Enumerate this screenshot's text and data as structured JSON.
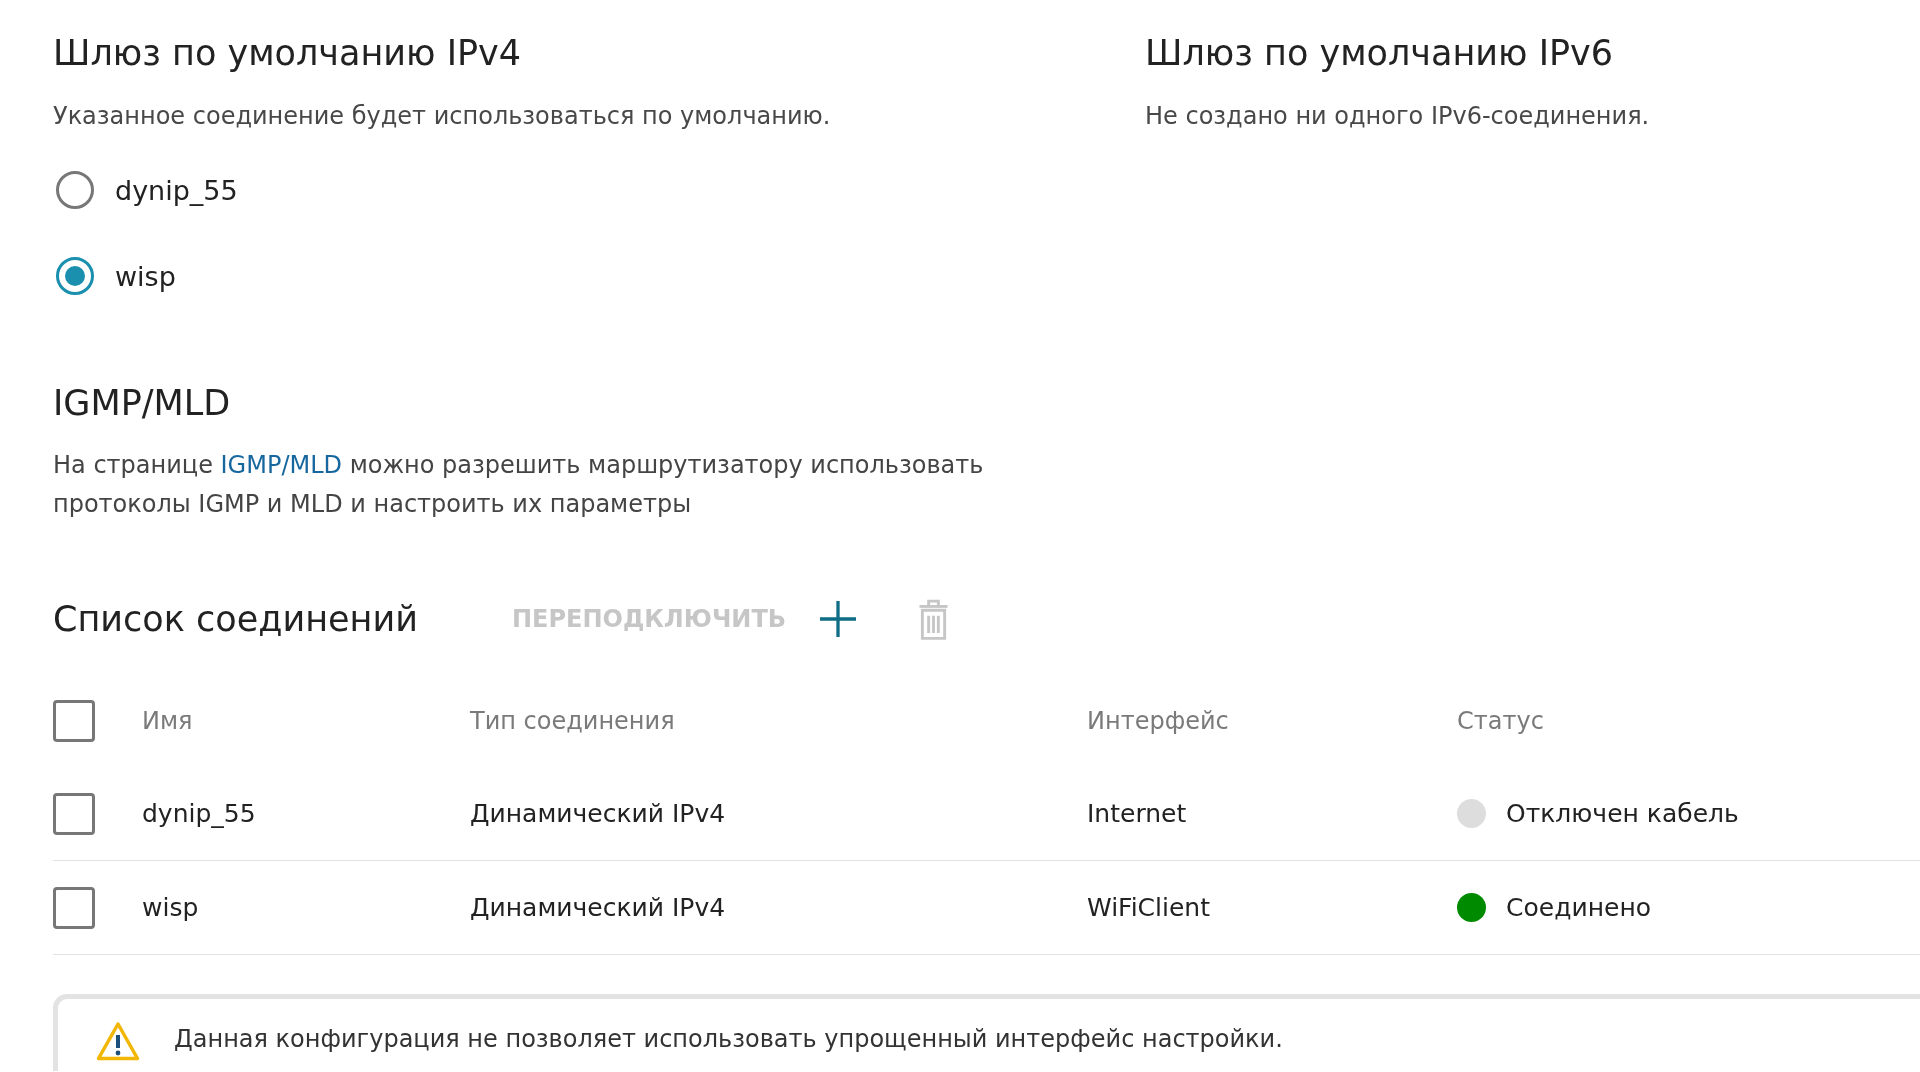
{
  "ipv4_gateway": {
    "title": "Шлюз по умолчанию IPv4",
    "description": "Указанное соединение будет использоваться по умолчанию.",
    "options": [
      {
        "label": "dynip_55",
        "selected": false
      },
      {
        "label": "wisp",
        "selected": true
      }
    ]
  },
  "ipv6_gateway": {
    "title": "Шлюз по умолчанию IPv6",
    "description": "Не создано ни одного IPv6-соединения."
  },
  "igmp_mld": {
    "title": "IGMP/MLD",
    "text_before": "На странице ",
    "link": "IGMP/MLD",
    "text_after": " можно разрешить маршрутизатору использовать протоколы IGMP и MLD и настроить их параметры"
  },
  "connections": {
    "title": "Список соединений",
    "reconnect_button": {
      "label": "ПЕРЕПОДКЛЮЧИТЬ",
      "disabled": true
    },
    "add_button": {
      "disabled": false
    },
    "delete_button": {
      "disabled": true
    },
    "table": {
      "select_all": {
        "checked": false
      },
      "columns": [
        "Имя",
        "Тип соединения",
        "Интерфейс",
        "Статус"
      ],
      "rows": [
        {
          "checked": false,
          "name": "dynip_55",
          "type": "Динамический IPv4",
          "interface": "Internet",
          "status": "Отключен кабель",
          "color": "#dddddd"
        },
        {
          "checked": false,
          "name": "wisp",
          "type": "Динамический IPv4",
          "interface": "WiFiClient",
          "status": "Соединено",
          "color": "#008a00"
        }
      ]
    }
  },
  "notice": {
    "text": "Данная конфигурация не позволяет использовать упрощенный интерфейс настройки."
  }
}
